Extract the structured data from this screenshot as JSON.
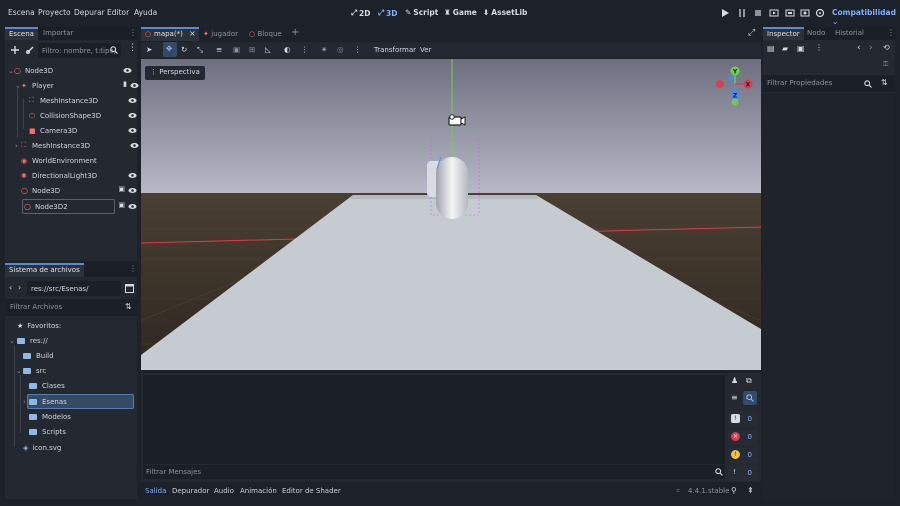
{
  "menu": [
    "Escena",
    "Proyecto",
    "Depurar",
    "Editor",
    "Ayuda"
  ],
  "modes": [
    {
      "label": "2D",
      "icon": "2d-icon"
    },
    {
      "label": "3D",
      "icon": "3d-icon",
      "active": true
    },
    {
      "label": "Script",
      "icon": "script-icon"
    },
    {
      "label": "Game",
      "icon": "game-icon"
    },
    {
      "label": "AssetLib",
      "icon": "assetlib-icon"
    }
  ],
  "renderer": "Compatibilidad ⌄",
  "scene_dock": {
    "tabs": [
      "Escena",
      "Importar"
    ],
    "filter_placeholder": "Filtro: nombre, t:tipo,",
    "tree": [
      {
        "label": "Node3D",
        "icon": "node3d-icon",
        "indent": 0
      },
      {
        "label": "Player",
        "icon": "character-icon",
        "indent": 1
      },
      {
        "label": "MeshInstance3D",
        "icon": "mesh-icon",
        "indent": 2
      },
      {
        "label": "CollisionShape3D",
        "icon": "collision-icon",
        "indent": 2
      },
      {
        "label": "Camera3D",
        "icon": "camera-icon",
        "indent": 2
      },
      {
        "label": "MeshInstance3D",
        "icon": "mesh-icon",
        "indent": 1
      },
      {
        "label": "WorldEnvironment",
        "icon": "world-icon",
        "indent": 1
      },
      {
        "label": "DirectionalLight3D",
        "icon": "light-icon",
        "indent": 1
      },
      {
        "label": "Node3D",
        "icon": "node3d-icon",
        "indent": 1
      },
      {
        "label": "Node3D2",
        "icon": "node3d-icon",
        "indent": 1
      }
    ]
  },
  "filesystem": {
    "title": "Sistema de archivos",
    "path": "res://src/Esenas/",
    "filter_placeholder": "Filtrar Archivos",
    "items": [
      {
        "label": "Favoritos:",
        "icon": "star-icon",
        "indent": 0
      },
      {
        "label": "res://",
        "icon": "folder-icon",
        "indent": 0
      },
      {
        "label": "Build",
        "icon": "folder-icon",
        "indent": 1
      },
      {
        "label": "src",
        "icon": "folder-icon",
        "indent": 1
      },
      {
        "label": "Clases",
        "icon": "folder-icon",
        "indent": 2
      },
      {
        "label": "Esenas",
        "icon": "folder-icon",
        "indent": 2,
        "selected": true
      },
      {
        "label": "Modelos",
        "icon": "folder-icon",
        "indent": 2
      },
      {
        "label": "Scripts",
        "icon": "folder-icon",
        "indent": 2
      },
      {
        "label": "icon.svg",
        "icon": "svg-file-icon",
        "indent": 1
      }
    ]
  },
  "scene_tabs": [
    {
      "label": "mapa(*)",
      "active": true
    },
    {
      "label": "jugador"
    },
    {
      "label": "Bloque"
    }
  ],
  "viewport": {
    "toolbar_menus": [
      "Transformar",
      "Ver"
    ],
    "perspective_label": "Perspectiva",
    "gizmo_axes": [
      "Y",
      "X",
      "Z"
    ]
  },
  "output": {
    "filter_placeholder": "Filtrar Mensajes",
    "counts": [
      "0",
      "0",
      "0",
      "0"
    ],
    "bottom_tabs": [
      "Salida",
      "Depurador",
      "Audio",
      "Animación",
      "Editor de Shader"
    ],
    "version": "4.4.1.stable"
  },
  "inspector": {
    "tabs": [
      "Inspector",
      "Nodo",
      "Historial"
    ],
    "filter_placeholder": "Filtrar Propiedades"
  },
  "colors": {
    "accent": "#6aa2ff",
    "sky": "#9a9db4",
    "ground": "#3a3128",
    "floor": "#c7ccd4"
  }
}
